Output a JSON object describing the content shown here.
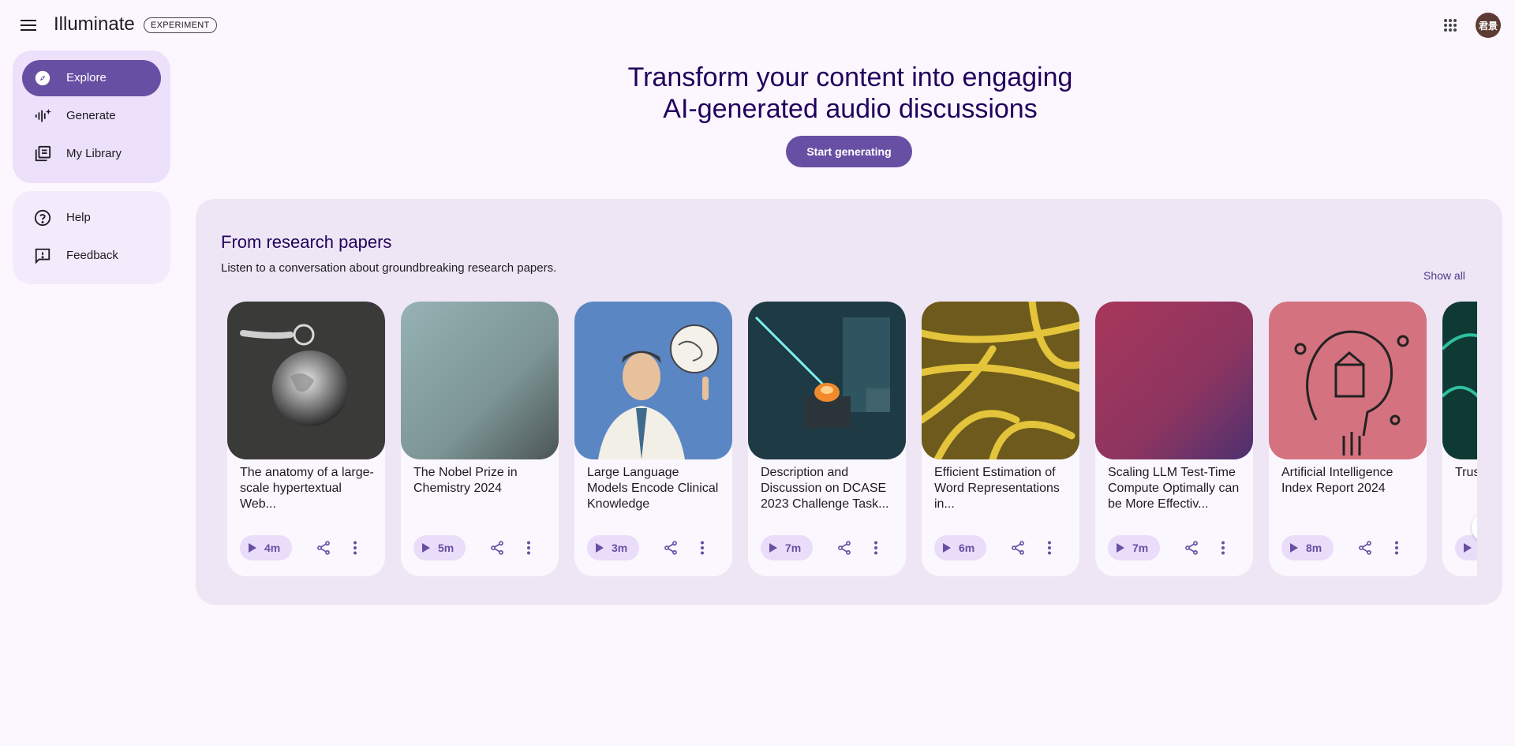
{
  "app": {
    "title": "Illuminate",
    "badge": "EXPERIMENT",
    "avatar_text": "君景"
  },
  "icons": {
    "menu": "menu-icon",
    "apps": "apps-grid-icon",
    "explore": "compass-icon",
    "generate": "sparkle-waveform-icon",
    "library": "library-icon",
    "help": "help-circle-icon",
    "feedback": "feedback-icon",
    "play": "play-icon",
    "share": "share-icon",
    "more": "more-vert-icon",
    "next": "chevron-right-icon"
  },
  "colors": {
    "primary": "#6750a4",
    "nav_bg": "#ece0fb",
    "section_bg": "#eee6f4",
    "title": "#21005d"
  },
  "sidebar": {
    "main": [
      {
        "label": "Explore",
        "active": true
      },
      {
        "label": "Generate",
        "active": false
      },
      {
        "label": "My Library",
        "active": false
      }
    ],
    "secondary": [
      {
        "label": "Help"
      },
      {
        "label": "Feedback"
      }
    ]
  },
  "hero": {
    "line1": "Transform your content into engaging",
    "line2": "AI-generated audio discussions",
    "cta": "Start generating"
  },
  "section": {
    "title": "From research papers",
    "subtitle": "Listen to a conversation about groundbreaking research papers.",
    "show_all": "Show all",
    "cards": [
      {
        "title": "The anatomy of a large-scale hypertextual Web...",
        "duration": "4m"
      },
      {
        "title": "The Nobel Prize in Chemistry 2024",
        "duration": "5m"
      },
      {
        "title": "Large Language Models Encode Clinical Knowledge",
        "duration": "3m"
      },
      {
        "title": "Description and Discussion on DCASE 2023 Challenge Task...",
        "duration": "7m"
      },
      {
        "title": "Efficient Estimation of Word Representations in...",
        "duration": "6m"
      },
      {
        "title": "Scaling LLM Test-Time Compute Optimally can be More Effectiv...",
        "duration": "7m"
      },
      {
        "title": "Artificial Intelligence Index Report 2024",
        "duration": "8m"
      },
      {
        "title": "Trus... Alig... Lan...",
        "duration": ""
      }
    ]
  }
}
